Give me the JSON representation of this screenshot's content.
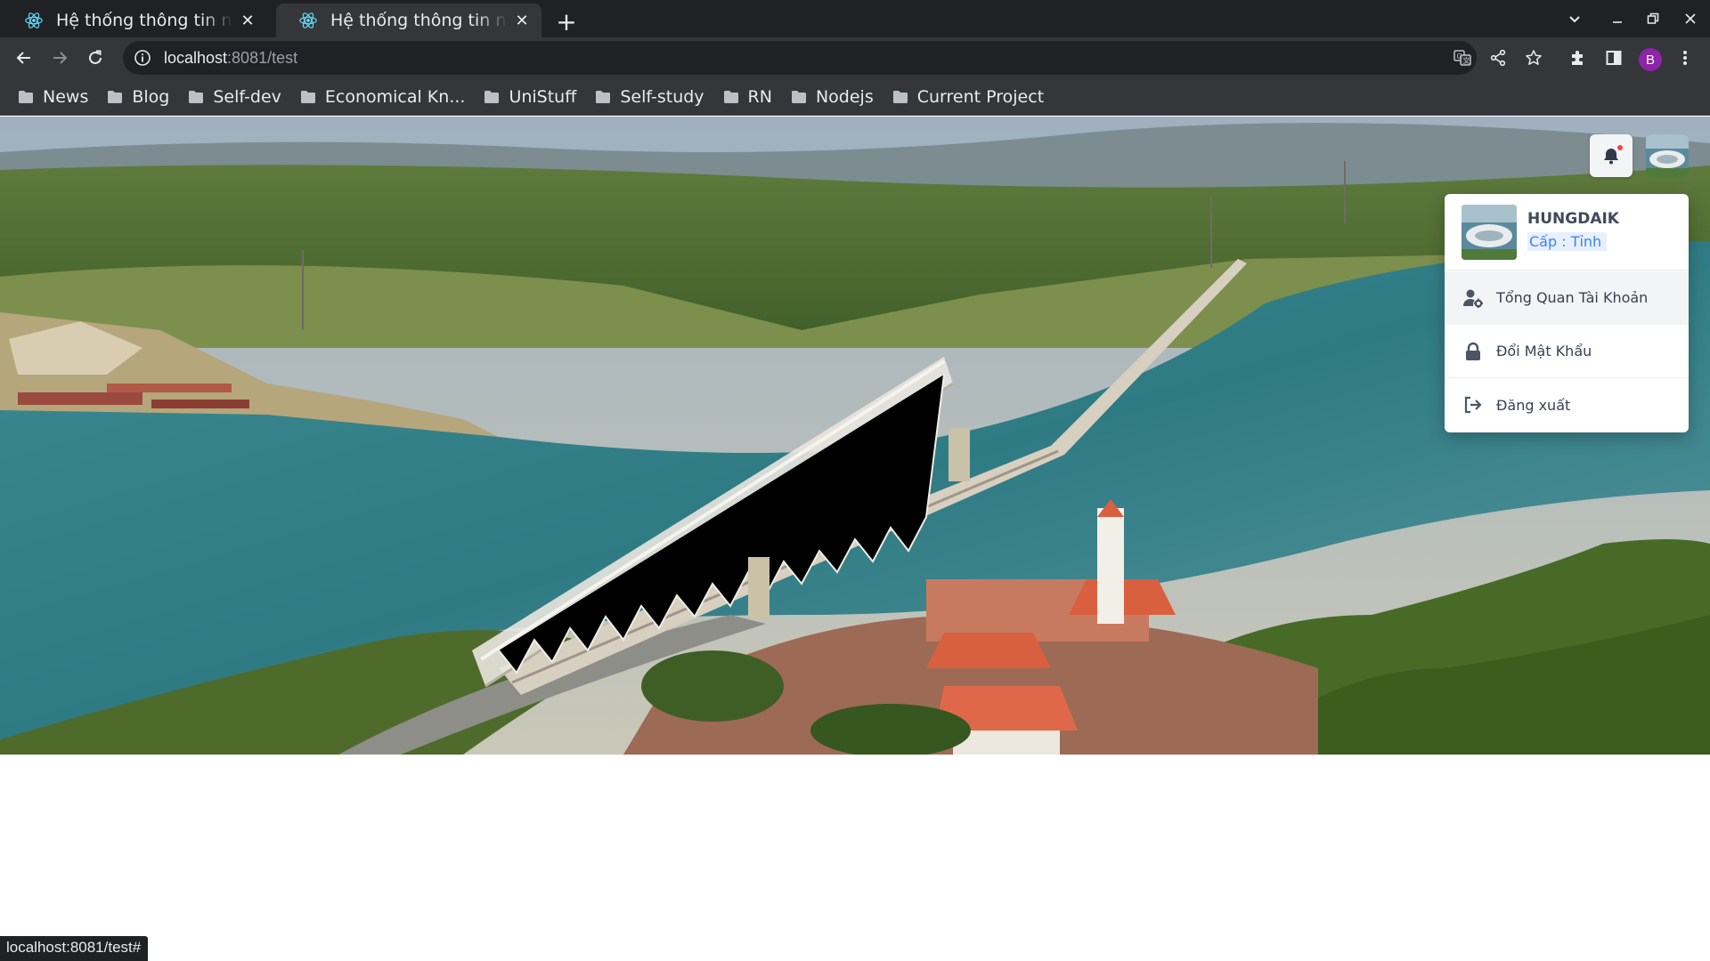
{
  "browser": {
    "tabs": [
      {
        "title": "Hệ thống thông tin nguồn",
        "active": false
      },
      {
        "title": "Hệ thống thông tin nguồn",
        "active": true
      }
    ],
    "url_host": "localhost",
    "url_rest": ":8081/test",
    "profile_initial": "B",
    "bookmarks": [
      "News",
      "Blog",
      "Self-dev",
      "Economical Kn...",
      "UniStuff",
      "Self-study",
      "RN",
      "Nodejs",
      "Current Project"
    ],
    "status_url": "localhost:8081/test#"
  },
  "header": {
    "icons": [
      "bell-icon",
      "user-avatar"
    ],
    "notification_dot_color": "#ef4444"
  },
  "user_menu": {
    "name": "HUNGDAIK",
    "level": "Cấp : Tỉnh",
    "items": [
      {
        "label": "Tổng Quan Tài Khoản",
        "icon": "user-gear-icon"
      },
      {
        "label": "Đổi Mật Khẩu",
        "icon": "lock-icon"
      },
      {
        "label": "Đăng xuất",
        "icon": "logout-icon"
      }
    ]
  },
  "colors": {
    "accent": "#3b82f6",
    "browser_bg": "#202124",
    "toolbar_bg": "#35363a"
  }
}
